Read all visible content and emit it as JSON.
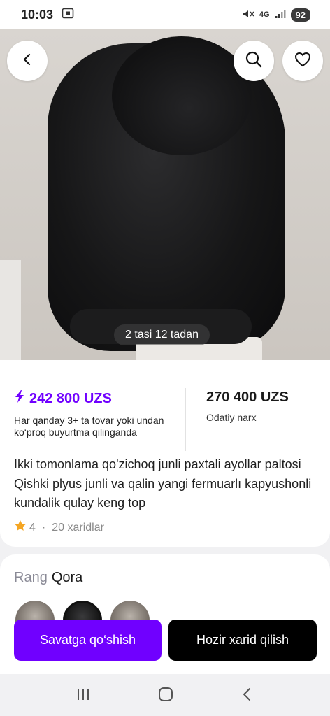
{
  "status_bar": {
    "time": "10:03",
    "network": "4G",
    "battery": "92"
  },
  "gallery": {
    "counter": "2 tasi 12 tadan"
  },
  "price": {
    "sale_price": "242 800 UZS",
    "sale_note": "Har qanday 3+ ta tovar yoki undan ko‘proq buyurtma qilinganda",
    "regular_price": "270 400 UZS",
    "regular_label": "Odatiy narx"
  },
  "product": {
    "title": "Ikki tomonlama qo'zichoq junli paxtali ayollar paltosi Qishki plyus junli va qalin yangi fermuarlı kapyushonli kundalik qulay keng top",
    "rating": "4",
    "separator": "·",
    "orders": "20 xaridlar"
  },
  "variant": {
    "label": "Rang",
    "value": "Qora"
  },
  "actions": {
    "add_to_cart": "Savatga qo‘shish",
    "buy_now": "Hozir xarid qilish"
  },
  "colors": {
    "accent": "#7000ff",
    "star": "#f5a623",
    "buy_button": "#000000"
  },
  "icons": {
    "back": "chevron-left-icon",
    "search": "search-icon",
    "favorite": "heart-icon",
    "lightning": "lightning-icon",
    "star": "star-icon",
    "nav_recent": "recent-apps-icon",
    "nav_home": "home-icon",
    "nav_back": "back-icon"
  }
}
